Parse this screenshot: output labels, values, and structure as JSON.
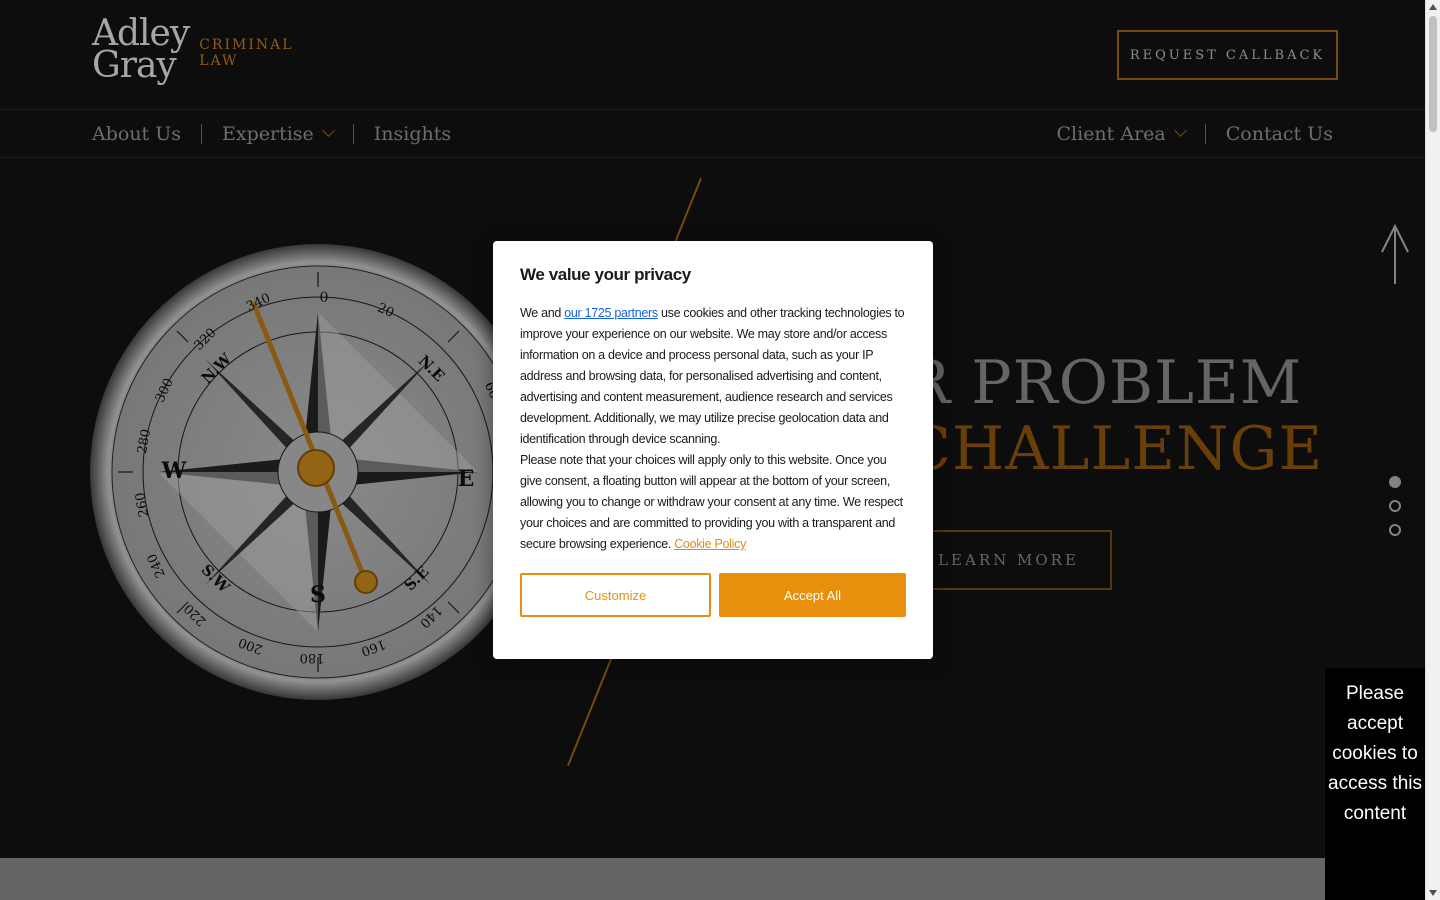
{
  "header": {
    "logo_main_line1": "Adley",
    "logo_main_line2": "Gray",
    "logo_sub_line1": "CRIMINAL",
    "logo_sub_line2": "LAW",
    "callback_label": "REQUEST CALLBACK"
  },
  "nav": {
    "left": [
      {
        "label": "About Us"
      },
      {
        "label": "Expertise"
      },
      {
        "label": "Insights"
      }
    ],
    "right": [
      {
        "label": "Client Area"
      },
      {
        "label": "Contact Us"
      }
    ]
  },
  "hero": {
    "title_line1": "R PROBLEM",
    "title_line2": "CHALLENGE",
    "learn_more_label": "LEARN MORE",
    "slide_count": 3,
    "active_slide": 1
  },
  "compass_labels": {
    "n": "N",
    "s": "S",
    "e": "E",
    "w": "W",
    "ne": "N.E",
    "nw": "N.W",
    "se": "S.E",
    "sw": "S.W",
    "deg0": "0",
    "deg20": "20",
    "deg60": "60",
    "deg140": "140",
    "deg160": "160",
    "deg180": "180",
    "deg200": "200",
    "deg220": "220",
    "deg240": "240",
    "deg260": "260",
    "deg280": "280",
    "deg300": "300",
    "deg320": "320",
    "deg340": "340"
  },
  "cookie_modal": {
    "title": "We value your privacy",
    "p1_before": "We and ",
    "p1_link": "our 1725 partners",
    "p1_after": " use cookies and other tracking technologies to improve your experience on our website. We may store and/or access information on a device and process personal data, such as your IP address and browsing data, for personalised advertising and content, advertising and content measurement, audience research and services development. Additionally, we may utilize precise geolocation data and identification through device scanning.",
    "p2_before": "Please note that your choices will apply only to this website. Once you give consent, a floating button will appear at the bottom of your screen, allowing you to change or withdraw your consent at any time. We respect your choices and are committed to providing you with a transparent and secure browsing experience. ",
    "p2_link": "Cookie Policy",
    "customize_label": "Customize",
    "accept_label": "Accept All"
  },
  "side_note": {
    "text": "Please accept cookies to access this content"
  },
  "colors": {
    "accent": "#e8900e",
    "background": "#141414",
    "link": "#1863dc"
  }
}
